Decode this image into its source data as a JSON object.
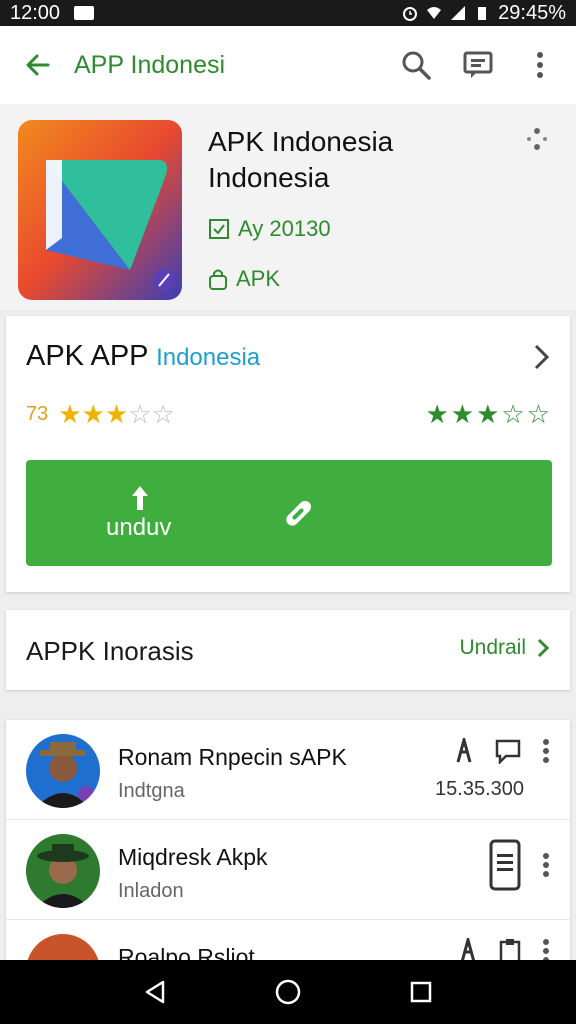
{
  "status": {
    "time": "12:00",
    "right_text": "29:45%"
  },
  "appbar": {
    "title": "APP Indonesia"
  },
  "app": {
    "name_line1": "APK Indonesia",
    "name_line2": "Indonesia",
    "meta1": "Ay 20130",
    "meta2": "APK"
  },
  "card": {
    "title_main": "APK APP",
    "title_accent": "Indonesia",
    "rating_value": "73",
    "rating_left_filled": 3,
    "rating_right_filled": 3,
    "install_label": "unduv"
  },
  "info": {
    "title": "APPK Inorasis",
    "more_label": "Undrail"
  },
  "list": [
    {
      "name": "Ronam Rnpecin sAPK",
      "sub": "Indtgna",
      "value": "15.35.300"
    },
    {
      "name": "Miqdresk Akpk",
      "sub": "Inladon",
      "value": ""
    },
    {
      "name": "Roalpo Rsljot",
      "sub": "",
      "value": ""
    }
  ],
  "colors": {
    "accent_green": "#2e8b2e",
    "button_green": "#3fae3f",
    "accent_blue": "#1e9fcf",
    "star": "#f0b400"
  },
  "icons": [
    "back-arrow-icon",
    "search-icon",
    "message-icon",
    "more-vert-icon",
    "download-icon",
    "link-icon",
    "chevron-right-icon",
    "phone-icon"
  ]
}
